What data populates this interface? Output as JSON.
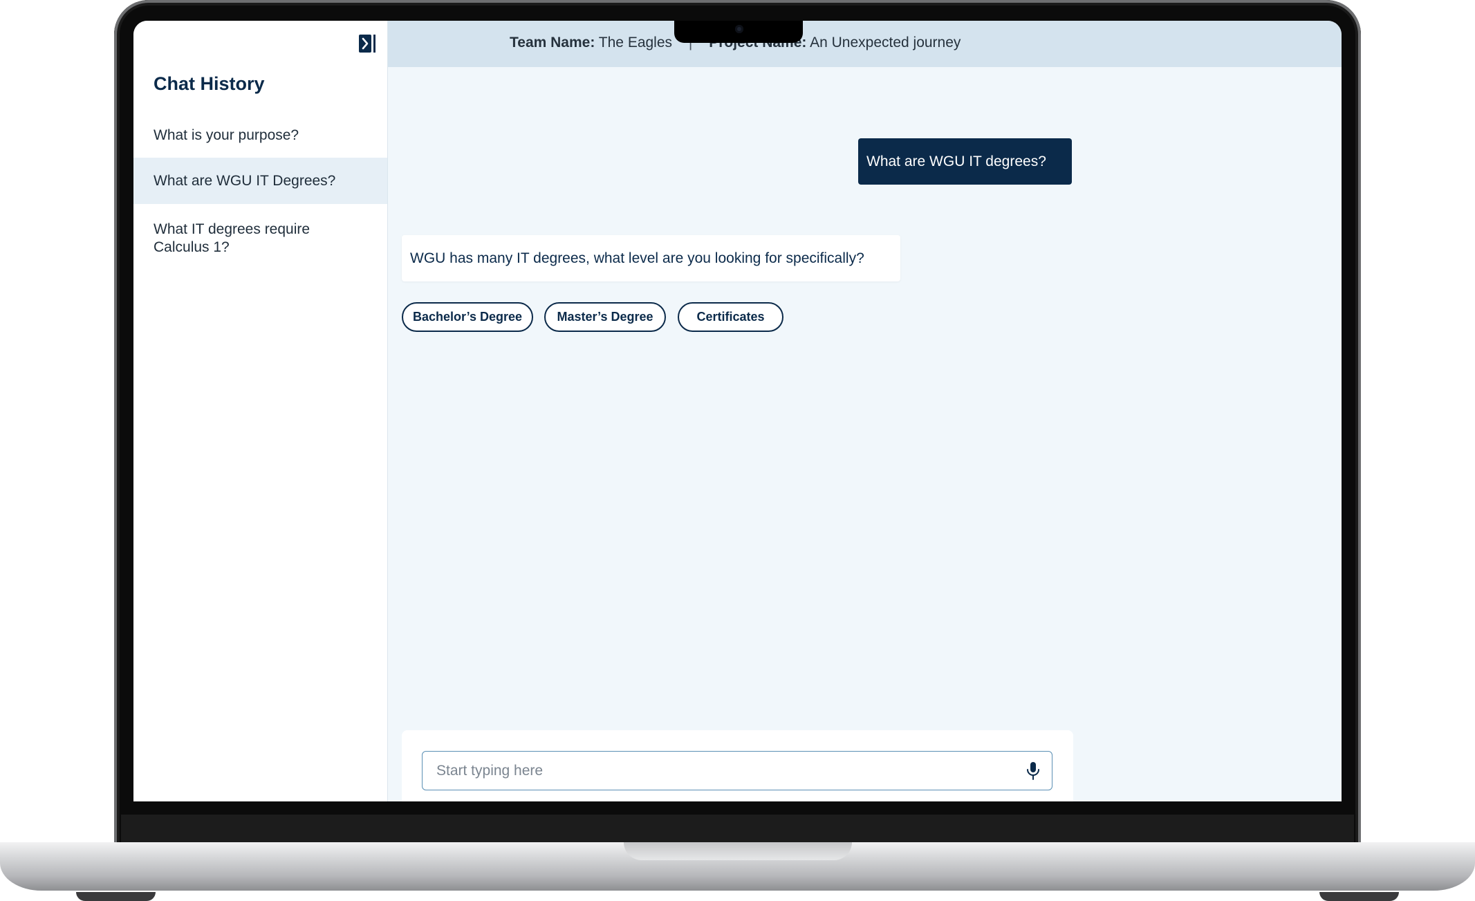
{
  "sidebar": {
    "title": "Chat History",
    "items": [
      {
        "label": "What is your purpose?",
        "active": false
      },
      {
        "label": "What are WGU IT Degrees?",
        "active": true
      },
      {
        "label": "What IT degrees require Calculus 1?",
        "active": false
      }
    ]
  },
  "header": {
    "team_label": "Team Name:",
    "team_value": "The Eagles",
    "separator": "|",
    "project_label": "Project Name:",
    "project_value": "An Unexpected journey"
  },
  "chat": {
    "user_message": "What are WGU IT degrees?",
    "bot_message": "WGU has many IT degrees, what level are you looking for specifically?",
    "options": [
      "Bachelor’s Degree",
      "Master’s Degree",
      "Certificates"
    ]
  },
  "composer": {
    "placeholder": "Start typing here",
    "value": ""
  },
  "icons": {
    "collapse": "sidebar-collapse-icon",
    "mic": "microphone-icon"
  },
  "colors": {
    "brand_navy": "#0b2a4a",
    "header_bg": "#d4e3ee",
    "chat_bg": "#f1f7fb",
    "active_item_bg": "#e6eff6"
  }
}
